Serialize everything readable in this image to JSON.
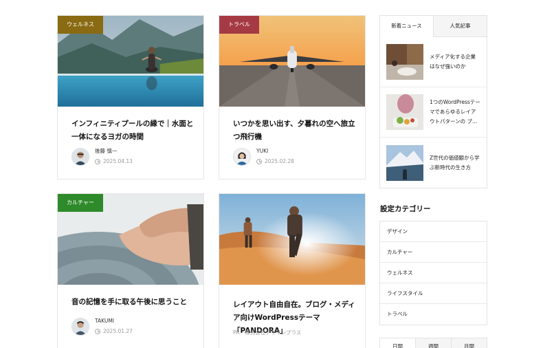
{
  "articles": [
    {
      "category": "ウェルネス",
      "category_color": "#8a6a12",
      "title": "インフィニティプールの縁で｜水面と一体になるヨガの時間",
      "author": "後藤 慎一",
      "date": "2025.04.13"
    },
    {
      "category": "トラベル",
      "category_color": "#a63a44",
      "title": "いつかを思い出す、夕暮れの空へ旅立つ飛行機",
      "author": "YUKI",
      "date": "2025.02.28"
    },
    {
      "category": "カルチャー",
      "category_color": "#2e8a2a",
      "title": "音の記憶を手に取る午後に思うこと",
      "author": "TAKUMI",
      "date": "2025.01.27"
    },
    {
      "title": "レイアウト自由自在。ブログ・メディア向けWordPressテーマ「PANDORA」",
      "pr_label": "PR　株式会社デザインプラス"
    }
  ],
  "sidebar": {
    "tabs": [
      "新着ニュース",
      "人気記事"
    ],
    "news": [
      {
        "title": "メディア化する企業はなぜ強いのか"
      },
      {
        "title": "1つのWordPressテーマであらゆるレイアウトパターンの ブ..."
      },
      {
        "title": "Z世代の価値観から学ぶ新時代の生き方"
      }
    ],
    "category_heading": "設定カテゴリー",
    "categories": [
      "デザイン",
      "カルチャー",
      "ウェルネス",
      "ライフスタイル",
      "トラベル"
    ],
    "ranking_tabs": [
      "日間",
      "週間",
      "月間"
    ]
  }
}
